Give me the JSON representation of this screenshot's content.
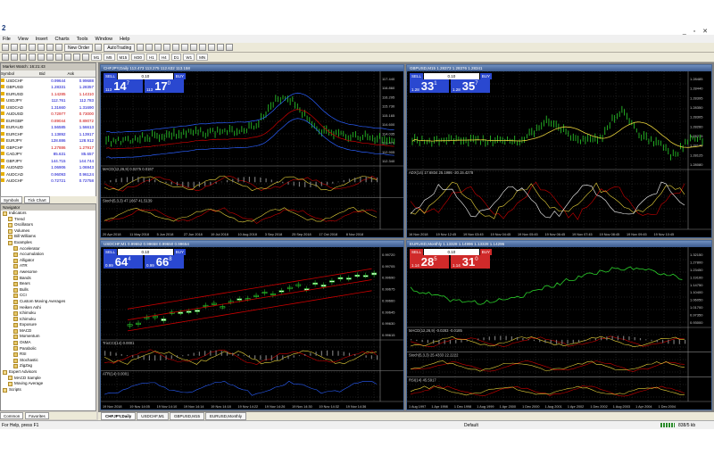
{
  "app": {
    "logo": "2"
  },
  "menu": [
    "File",
    "View",
    "Insert",
    "Charts",
    "Tools",
    "Window",
    "Help"
  ],
  "toolbar": {
    "new_order": "New Order",
    "autotrading": "AutoTrading",
    "timeframes": [
      "M1",
      "M5",
      "M15",
      "M30",
      "H1",
      "H4",
      "D1",
      "W1",
      "MN"
    ]
  },
  "market_watch": {
    "title": "Market Watch: 16:21:43",
    "columns": [
      "Symbol",
      "Bid",
      "Ask"
    ],
    "rows": [
      {
        "symbol": "USDCHF",
        "bid": "0.99644",
        "ask": "0.99688",
        "color": "#0000cc"
      },
      {
        "symbol": "GBPUSD",
        "bid": "1.28331",
        "ask": "1.28357",
        "color": "#0000cc"
      },
      {
        "symbol": "EURUSD",
        "bid": "1.14285",
        "ask": "1.14310",
        "color": "#cc0000"
      },
      {
        "symbol": "USDJPY",
        "bid": "112.761",
        "ask": "112.783",
        "color": "#0000cc"
      },
      {
        "symbol": "USDCAD",
        "bid": "1.31660",
        "ask": "1.31690",
        "color": "#0000cc"
      },
      {
        "symbol": "AUDUSD",
        "bid": "0.72977",
        "ask": "0.73000",
        "color": "#cc0000"
      },
      {
        "symbol": "EURGBP",
        "bid": "0.89044",
        "ask": "0.89072",
        "color": "#cc0000"
      },
      {
        "symbol": "EURAUD",
        "bid": "1.56585",
        "ask": "1.56613",
        "color": "#0000cc"
      },
      {
        "symbol": "EURCHF",
        "bid": "1.13892",
        "ask": "1.13917",
        "color": "#0000cc"
      },
      {
        "symbol": "EURJPY",
        "bid": "128.886",
        "ask": "128.912",
        "color": "#0000cc"
      },
      {
        "symbol": "GBPCHF",
        "bid": "1.27886",
        "ask": "1.27917",
        "color": "#cc0000"
      },
      {
        "symbol": "CADJPY",
        "bid": "85.631",
        "ask": "85.657",
        "color": "#0000cc"
      },
      {
        "symbol": "GBPJPY",
        "bid": "144.715",
        "ask": "144.744",
        "color": "#0000cc"
      },
      {
        "symbol": "AUDNZD",
        "bid": "1.06906",
        "ask": "1.06943",
        "color": "#0000cc"
      },
      {
        "symbol": "AUDCAD",
        "bid": "0.96093",
        "ask": "0.96124",
        "color": "#0000cc"
      },
      {
        "symbol": "AUDCHF",
        "bid": "0.72721",
        "ask": "0.72758",
        "color": "#0000cc"
      }
    ],
    "tabs": [
      "Symbols",
      "Tick Chart"
    ]
  },
  "navigator": {
    "title": "Navigator",
    "items": [
      {
        "label": "Indicators",
        "level": 0
      },
      {
        "label": "Trend",
        "level": 1
      },
      {
        "label": "Oscillators",
        "level": 1
      },
      {
        "label": "Volumes",
        "level": 1
      },
      {
        "label": "Bill Williams",
        "level": 1
      },
      {
        "label": "Examples",
        "level": 1
      },
      {
        "label": "Accelerator",
        "level": 2
      },
      {
        "label": "Accumulation",
        "level": 2
      },
      {
        "label": "Alligator",
        "level": 2
      },
      {
        "label": "ATR",
        "level": 2
      },
      {
        "label": "Awesome",
        "level": 2
      },
      {
        "label": "Bands",
        "level": 2
      },
      {
        "label": "Bears",
        "level": 2
      },
      {
        "label": "Bulls",
        "level": 2
      },
      {
        "label": "CCI",
        "level": 2
      },
      {
        "label": "Custom Moving Averages",
        "level": 2
      },
      {
        "label": "Heiken Ashi",
        "level": 2
      },
      {
        "label": "Ichimoku",
        "level": 2
      },
      {
        "label": "Ichimoku",
        "level": 2
      },
      {
        "label": "Exposure",
        "level": 2
      },
      {
        "label": "MACD",
        "level": 2
      },
      {
        "label": "Momentum",
        "level": 2
      },
      {
        "label": "OsMA",
        "level": 2
      },
      {
        "label": "Parabolic",
        "level": 2
      },
      {
        "label": "RSI",
        "level": 2
      },
      {
        "label": "Stochastic",
        "level": 2
      },
      {
        "label": "ZigZag",
        "level": 2
      },
      {
        "label": "Expert Advisors",
        "level": 0
      },
      {
        "label": "MACD Sample",
        "level": 1
      },
      {
        "label": "Moving Average",
        "level": 1
      },
      {
        "label": "Scripts",
        "level": 0
      }
    ],
    "tabs": [
      "Common",
      "Favorites"
    ]
  },
  "charts": [
    {
      "title": "CHFJPY,Daily 113.473 113.275 112.632 113.158",
      "otp": {
        "sell": "SELL",
        "lot": "0.10",
        "buy": "BUY",
        "bid_small": "113",
        "bid_big": "14",
        "bid_sup": "7",
        "ask_small": "113",
        "ask_big": "17",
        "ask_sup": "0"
      },
      "ind": [
        "MACD(12,26,9) 0.0275 0.0167",
        "Stoch(5,3,3) 47.1667 41.5139"
      ],
      "dates": [
        "20 Apr 2018",
        "11 May 2018",
        "5 Jun 2018",
        "27 Jun 2018",
        "19 Jul 2018",
        "10 Aug 2018",
        "3 Sep 2018",
        "25 Sep 2018",
        "17 Oct 2018",
        "8 Nov 2018"
      ],
      "prices": [
        "117.440",
        "116.860",
        "116.295",
        "115.730",
        "115.165",
        "114.600",
        "114.035",
        "113.470",
        "112.905",
        "112.340"
      ],
      "red": false
    },
    {
      "title": "GBPUSD,M15 1.28373 1.28376 1.28341",
      "otp": {
        "sell": "SELL",
        "lot": "0.10",
        "buy": "BUY",
        "bid_small": "1.28",
        "bid_big": "33",
        "bid_sup": "1",
        "ask_small": "1.28",
        "ask_big": "35",
        "ask_sup": "7"
      },
      "ind": [
        "ADX(14) 17.6834 25.1986 -20.15.4278"
      ],
      "dates": [
        "16 Nov 2018",
        "19 Nov 12:45",
        "19 Nov 03:45",
        "19 Nov 04:45",
        "19 Nov 05:45",
        "19 Nov 06:45",
        "19 Nov 07:45",
        "19 Nov 08:45",
        "19 Nov 09:45",
        "19 Nov 10:45"
      ],
      "prices": [
        "1.28485",
        "1.28440",
        "1.28395",
        "1.28350",
        "1.28305",
        "1.28260",
        "1.28215",
        "1.28170",
        "1.28125",
        "1.28080"
      ],
      "red": false
    },
    {
      "title": "USDCHF,M1 0.99652 0.99658 0.99650 0.99654",
      "otp": {
        "sell": "SELL",
        "lot": "0.10",
        "buy": "BUY",
        "bid_small": "0.99",
        "bid_big": "64",
        "bid_sup": "4",
        "ask_small": "0.99",
        "ask_big": "66",
        "ask_sup": "8"
      },
      "ind": [
        "TrixCCI(14) 0.0001",
        "ATR(14) 0.0001"
      ],
      "dates": [
        "19 Nov 2018",
        "19 Nov 14:05",
        "19 Nov 14:10",
        "19 Nov 14:14",
        "19 Nov 14:18",
        "19 Nov 14:22",
        "19 Nov 14:26",
        "19 Nov 14:30",
        "19 Nov 14:32",
        "19 Nov 14:36"
      ],
      "prices": [
        "0.99720",
        "0.99705",
        "0.99690",
        "0.99675",
        "0.99660",
        "0.99645",
        "0.99630",
        "0.99615"
      ],
      "red": false
    },
    {
      "title": "EURUSD,Monthly 1.13328 1.14996 1.13328 1.14296",
      "otp": {
        "sell": "SELL",
        "lot": "0.10",
        "buy": "BUY",
        "bid_small": "1.14",
        "bid_big": "28",
        "bid_sup": "5",
        "ask_small": "1.14",
        "ask_big": "31",
        "ask_sup": "0"
      },
      "ind": [
        "MACD(12,26,9) -0.0283 -0.0185",
        "Stoch(5,3,3) 25.4333 22.2222",
        "RSI(14) 45.5917"
      ],
      "dates": [
        "1 Aug 1997",
        "1 Apr 1998",
        "1 Dec 1998",
        "1 Aug 1999",
        "1 Apr 2000",
        "1 Dec 2000",
        "1 Aug 2001",
        "1 Apr 2002",
        "1 Dec 2002",
        "1 Aug 2003",
        "1 Apr 2004",
        "1 Dec 2004"
      ],
      "prices": [
        "1.32150",
        "1.27800",
        "1.23450",
        "1.19100",
        "1.14750",
        "1.10400",
        "1.06050",
        "1.01700",
        "0.97350",
        "0.93000"
      ],
      "red": true
    }
  ],
  "chart_tabs": [
    "CHFJPY,Daily",
    "USDCHF,M1",
    "GBPUSD,M15",
    "EURUSD,Monthly"
  ],
  "status": {
    "help": "For Help, press F1",
    "profile": "Default",
    "size": "838/5 kb"
  }
}
